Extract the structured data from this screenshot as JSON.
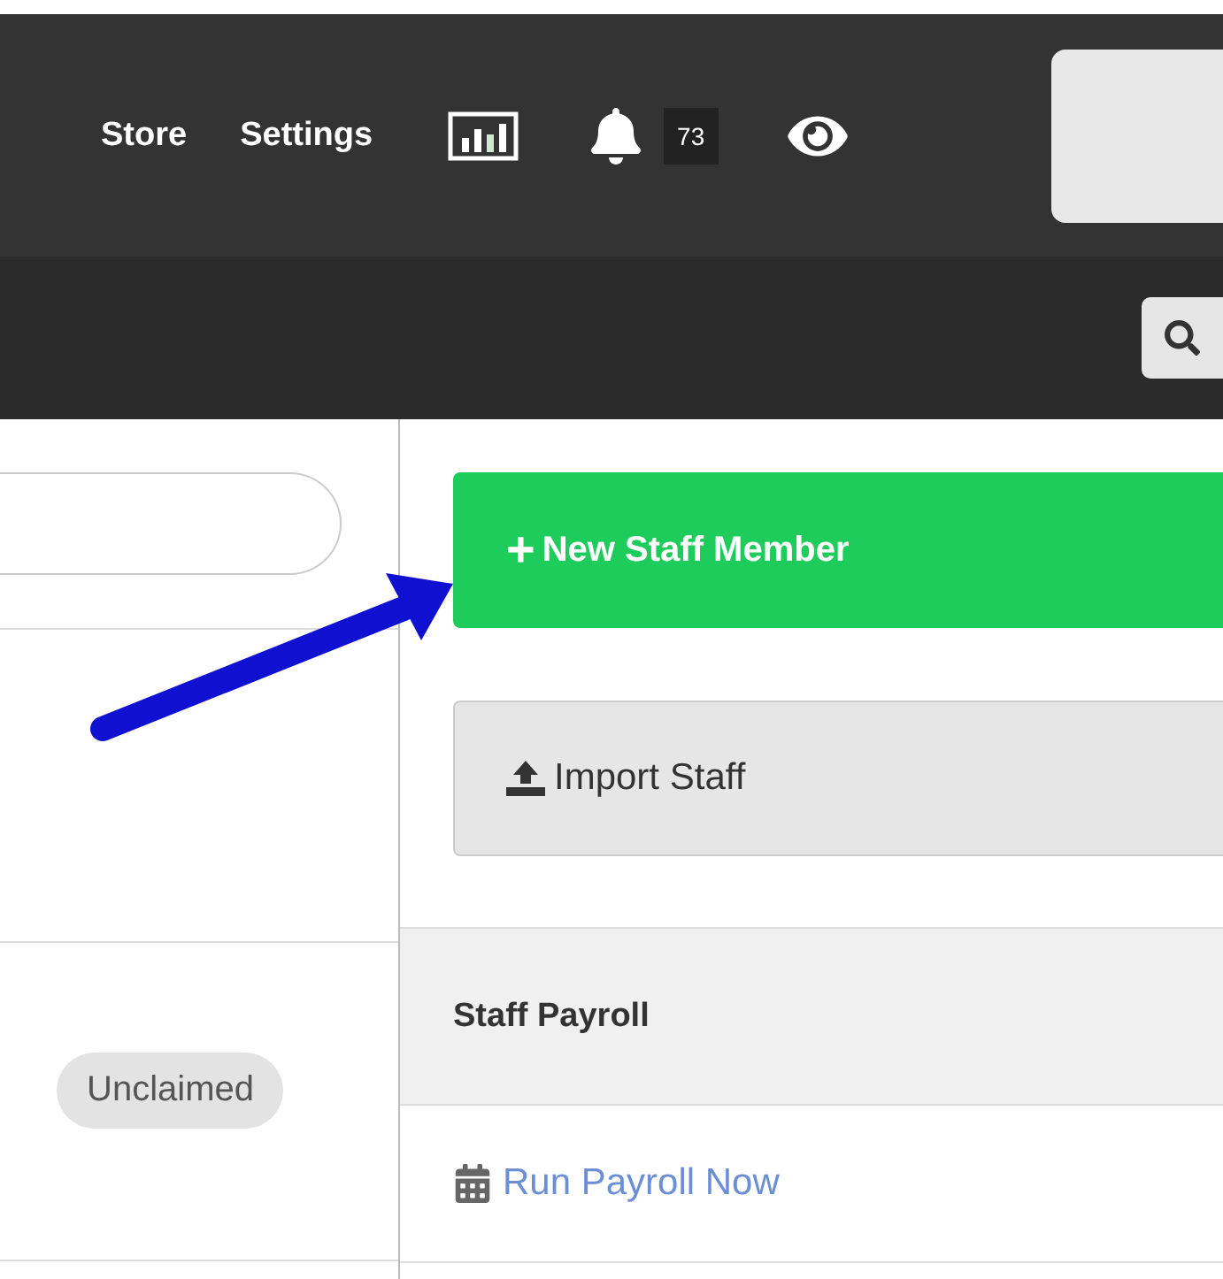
{
  "nav": {
    "links": [
      "Store",
      "Settings"
    ],
    "notification_count": "73"
  },
  "left": {
    "status_badge": "Unclaimed"
  },
  "right": {
    "new_button": {
      "icon": "+",
      "label": "New Staff Member"
    },
    "import_button": {
      "label": "Import Staff"
    },
    "panel": {
      "title": "Staff Payroll",
      "link": "Run Payroll Now"
    }
  }
}
